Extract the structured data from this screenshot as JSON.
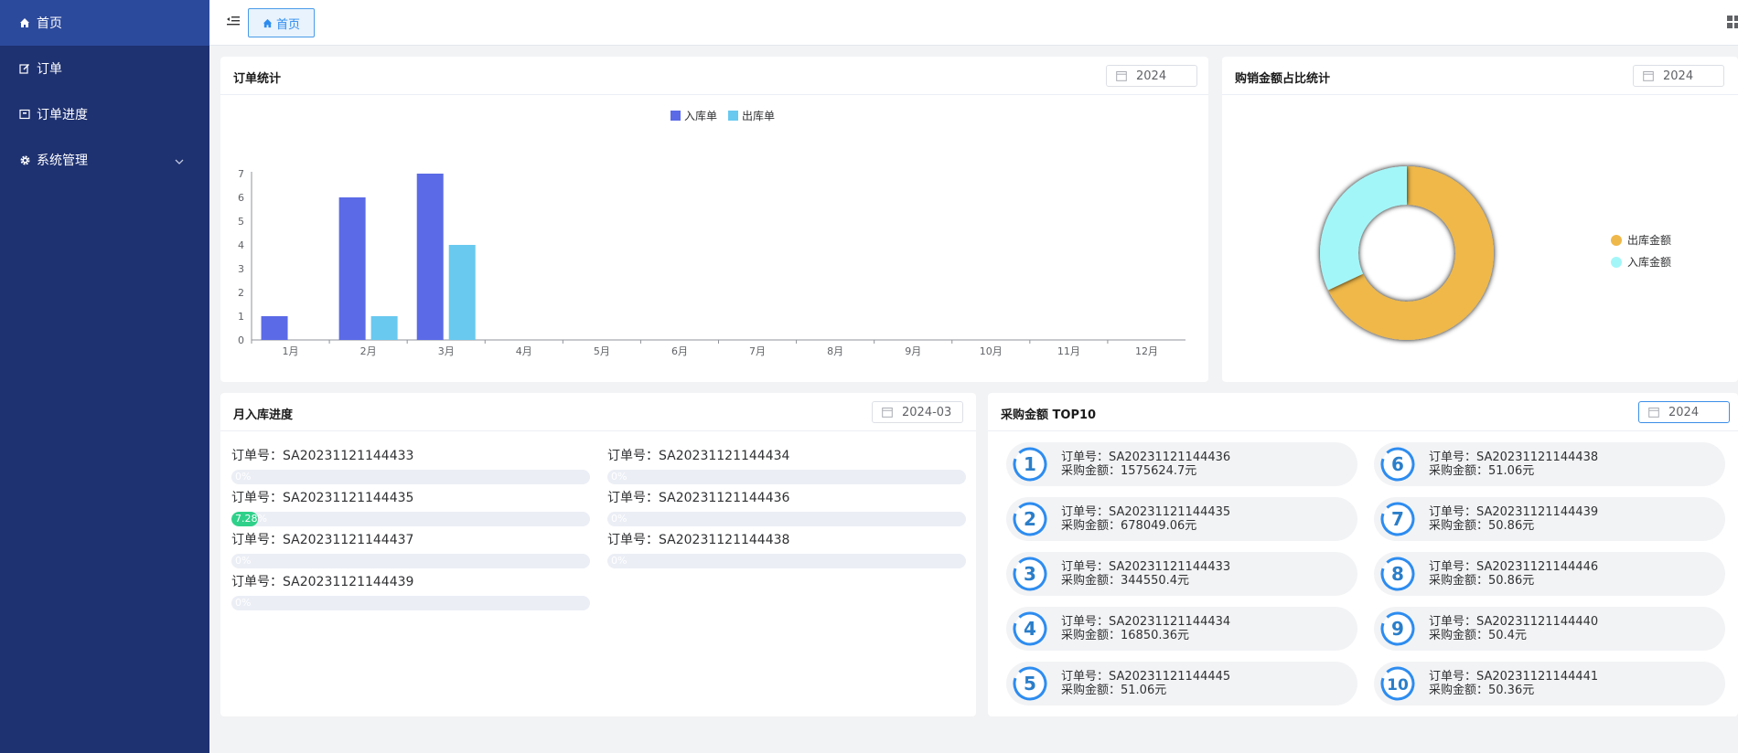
{
  "sidebar": {
    "items": [
      {
        "label": "首页",
        "icon": "home-icon",
        "active": true
      },
      {
        "label": "订单",
        "icon": "edit-icon"
      },
      {
        "label": "订单进度",
        "icon": "progress-icon"
      },
      {
        "label": "系统管理",
        "icon": "gear-icon",
        "expandable": true
      }
    ]
  },
  "header": {
    "tab_label": "首页"
  },
  "orders_card": {
    "title": "订单统计",
    "year": "2024"
  },
  "ratio_card": {
    "title": "购销金额占比统计",
    "year": "2024"
  },
  "month_card": {
    "title": "月入库进度",
    "month": "2024-03",
    "items": [
      {
        "label": "订单号：SA20231121144433",
        "percent": 0,
        "text": "0%"
      },
      {
        "label": "订单号：SA20231121144434",
        "percent": 0,
        "text": "0%"
      },
      {
        "label": "订单号：SA20231121144435",
        "percent": 7.28,
        "text": "7.28%"
      },
      {
        "label": "订单号：SA20231121144436",
        "percent": 0,
        "text": "0%"
      },
      {
        "label": "订单号：SA20231121144437",
        "percent": 0,
        "text": "0%"
      },
      {
        "label": "订单号：SA20231121144438",
        "percent": 0,
        "text": "0%"
      },
      {
        "label": "订单号：SA20231121144439",
        "percent": 0,
        "text": "0%"
      }
    ]
  },
  "top10_card": {
    "title": "采购金额 TOP10",
    "year": "2024",
    "items": [
      {
        "rank": "1",
        "order": "订单号：SA20231121144436",
        "amount": "采购金额：1575624.7元"
      },
      {
        "rank": "2",
        "order": "订单号：SA20231121144435",
        "amount": "采购金额：678049.06元"
      },
      {
        "rank": "3",
        "order": "订单号：SA20231121144433",
        "amount": "采购金额：344550.4元"
      },
      {
        "rank": "4",
        "order": "订单号：SA20231121144434",
        "amount": "采购金额：16850.36元"
      },
      {
        "rank": "5",
        "order": "订单号：SA20231121144445",
        "amount": "采购金额：51.06元"
      },
      {
        "rank": "6",
        "order": "订单号：SA20231121144438",
        "amount": "采购金额：51.06元"
      },
      {
        "rank": "7",
        "order": "订单号：SA20231121144439",
        "amount": "采购金额：50.86元"
      },
      {
        "rank": "8",
        "order": "订单号：SA20231121144446",
        "amount": "采购金额：50.86元"
      },
      {
        "rank": "9",
        "order": "订单号：SA20231121144440",
        "amount": "采购金额：50.4元"
      },
      {
        "rank": "10",
        "order": "订单号：SA20231121144441",
        "amount": "采购金额：50.36元"
      }
    ]
  },
  "colors": {
    "sidebar_bg": "#1e3170",
    "sidebar_active": "#2c4a9c",
    "bar_in": "#5b6ae6",
    "bar_out": "#69c9ef",
    "pie_out": "#efb84a",
    "pie_in": "#a3f6f8",
    "progress": "#2fd18a",
    "rank_ring": "#2d8cf0"
  },
  "chart_data": [
    {
      "type": "bar",
      "categories": [
        "1月",
        "2月",
        "3月",
        "4月",
        "5月",
        "6月",
        "7月",
        "8月",
        "9月",
        "10月",
        "11月",
        "12月"
      ],
      "series": [
        {
          "name": "入库单",
          "values": [
            1,
            6,
            7,
            0,
            0,
            0,
            0,
            0,
            0,
            0,
            0,
            0
          ]
        },
        {
          "name": "出库单",
          "values": [
            0,
            1,
            4,
            0,
            0,
            0,
            0,
            0,
            0,
            0,
            0,
            0
          ]
        }
      ],
      "yticks": [
        "0",
        "1",
        "2",
        "3",
        "4",
        "5",
        "6",
        "7"
      ],
      "ylim": [
        0,
        7
      ],
      "legend": "top-center",
      "grid": false
    },
    {
      "type": "pie",
      "donut": true,
      "labels": [
        "出库金额",
        "入库金额"
      ],
      "values": [
        68,
        32
      ],
      "legend": "right"
    }
  ]
}
